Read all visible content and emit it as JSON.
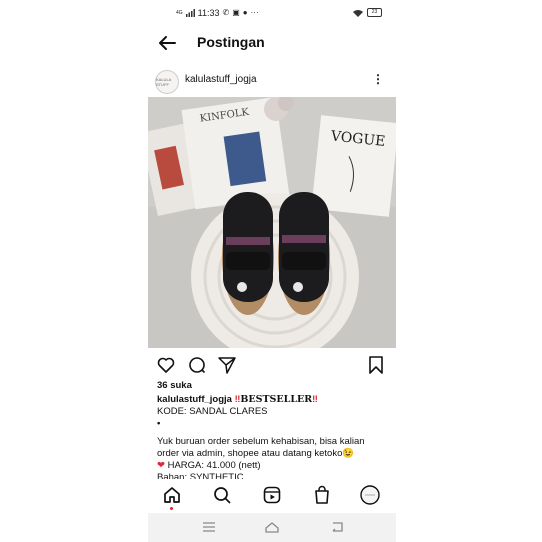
{
  "status_bar": {
    "time": "11:33",
    "network": "4G",
    "battery": "23"
  },
  "header": {
    "title": "Postingan"
  },
  "post": {
    "username": "kalulastuff_jogja",
    "avatar_text": "KALULA STUFF",
    "likes": "36 suka",
    "caption": {
      "username": "kalulastuff_jogja",
      "bang1": "‼",
      "tag": "BESTSELLER",
      "bang2": "‼",
      "line2": "KODE: SANDAL CLARES",
      "line3": "•",
      "line4": "Yuk buruan order sebelum kehabisan, bisa kalian order via admin, shopee atau datang ketoko😉",
      "heart": "❤",
      "line5": " HARGA: 41.000 (nett)",
      "line6": "Bahan: SYNTHETIC"
    },
    "photo_text": {
      "magazine1": "KINFOLK",
      "magazine2": "VOGUE"
    }
  },
  "icons": {
    "back": "arrow-left-icon",
    "more": "more-vertical-icon",
    "like": "heart-icon",
    "comment": "comment-icon",
    "share": "send-icon",
    "save": "bookmark-icon",
    "home": "home-icon",
    "search": "search-icon",
    "reels": "reels-icon",
    "shop": "shop-bag-icon",
    "profile": "profile-avatar-icon"
  },
  "colors": {
    "accent_red": "#e0263a",
    "text": "#111111"
  }
}
